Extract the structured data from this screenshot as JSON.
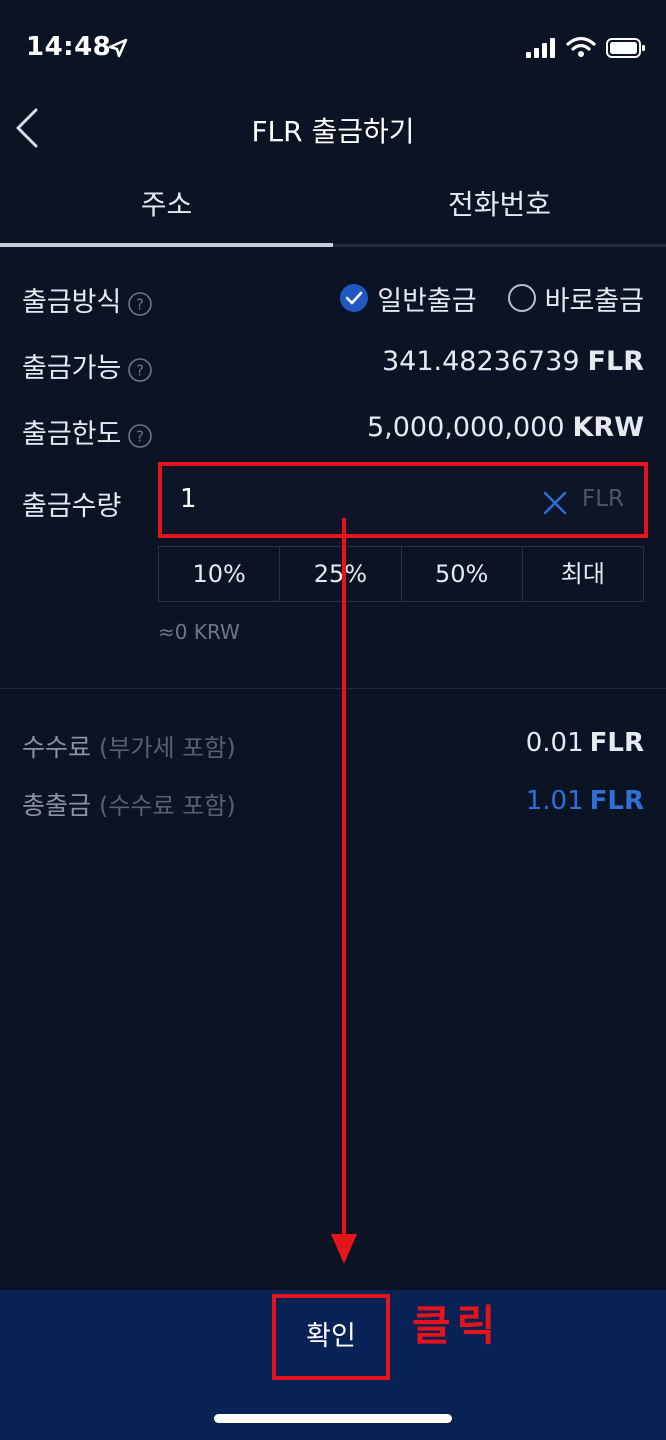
{
  "status_bar": {
    "time": "14:48"
  },
  "header": {
    "title": "FLR 출금하기"
  },
  "tabs": [
    {
      "label": "주소",
      "active": true
    },
    {
      "label": "전화번호",
      "active": false
    }
  ],
  "withdraw_method": {
    "label": "출금방식",
    "options": [
      {
        "label": "일반출금",
        "selected": true
      },
      {
        "label": "바로출금",
        "selected": false
      }
    ]
  },
  "available": {
    "label": "출금가능",
    "amount": "341.48236739",
    "unit": "FLR"
  },
  "limit": {
    "label": "출금한도",
    "amount": "5,000,000,000",
    "unit": "KRW"
  },
  "amount": {
    "label": "출금수량",
    "value": "1",
    "unit": "FLR",
    "quick_buttons": [
      "10%",
      "25%",
      "50%",
      "최대"
    ],
    "krw_estimate": "≈0 KRW"
  },
  "fee": {
    "label": "수수료",
    "note": "(부가세 포함)",
    "amount": "0.01",
    "unit": "FLR"
  },
  "total": {
    "label": "총출금",
    "note": "(수수료 포함)",
    "amount": "1.01",
    "unit": "FLR"
  },
  "confirm_button": {
    "label": "확인"
  },
  "annotation": {
    "click_note": "클릭"
  },
  "colors": {
    "background": "#0a1424",
    "accent_blue": "#2f6fd6",
    "highlight_red": "#e5141b",
    "bottom_bar": "#082255"
  }
}
